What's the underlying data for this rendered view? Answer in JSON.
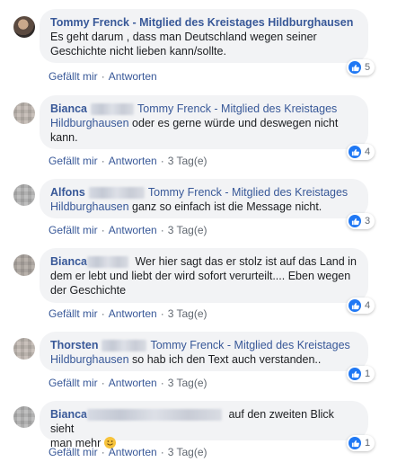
{
  "comments": [
    {
      "author": "Tommy Frenck - Mitglied des Kreistages Hildburghausen",
      "text": "Es geht darum , dass man Deutschland wegen seiner Geschichte nicht lieben kann/sollte.",
      "like": "Gefällt mir",
      "reply": "Antworten",
      "time": "",
      "reactions": "5"
    },
    {
      "author": "Bianca",
      "tag_line1": "Tommy Frenck - Mitglied des Kreistages",
      "tag_line2": "Hildburghausen",
      "text": " oder es gerne würde und deswegen nicht kann.",
      "like": "Gefällt mir",
      "reply": "Antworten",
      "time": "3 Tag(e)",
      "reactions": "4"
    },
    {
      "author": "Alfons",
      "tag_line1": "Tommy Frenck - Mitglied des Kreistages",
      "tag_line2": "Hildburghausen",
      "text": " ganz so einfach ist die Message nicht.",
      "like": "Gefällt mir",
      "reply": "Antworten",
      "time": "3 Tag(e)",
      "reactions": "3"
    },
    {
      "author": "Bianca",
      "text_line1": " Wer hier sagt das er stolz ist auf das Land in",
      "text_line2": "dem er lebt und liebt der wird sofort verurteilt.... Eben wegen",
      "text_line3": "der Geschichte",
      "like": "Gefällt mir",
      "reply": "Antworten",
      "time": "3 Tag(e)",
      "reactions": "4"
    },
    {
      "author": "Thorsten",
      "tag_line1": "Tommy Frenck - Mitglied des Kreistages",
      "tag_line2": "Hildburghausen",
      "text": " so hab ich den Text auch verstanden..",
      "like": "Gefällt mir",
      "reply": "Antworten",
      "time": "3 Tag(e)",
      "reactions": "1"
    },
    {
      "author": "Bianca",
      "text_line1": " auf den zweiten Blick sieht",
      "text_line2": "man mehr",
      "like": "Gefällt mir",
      "reply": "Antworten",
      "time": "3 Tag(e)",
      "reactions": "1"
    }
  ],
  "colors": {
    "link": "#385898",
    "bubble": "#f2f3f5",
    "like_badge": "#2078f4"
  },
  "icons": {
    "reaction": "like-thumb-icon",
    "emoji": "smile-emoji-icon"
  }
}
